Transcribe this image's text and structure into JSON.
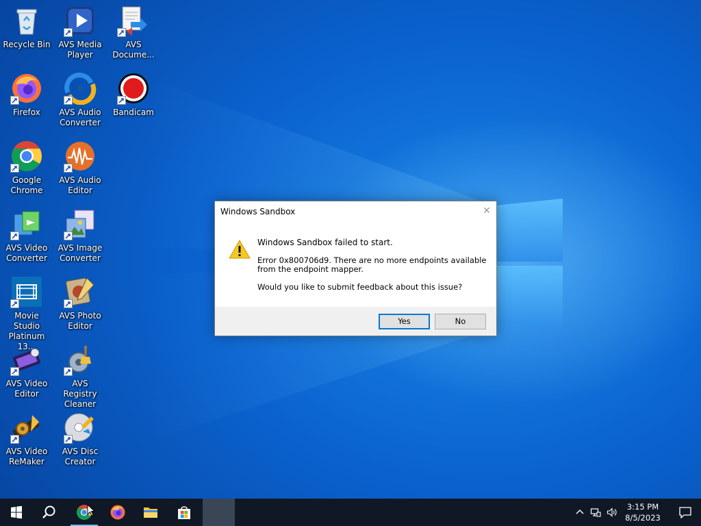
{
  "desktop": {
    "icons": [
      {
        "label": "Recycle Bin",
        "icon": "recycle-bin-icon"
      },
      {
        "label": "AVS Media Player",
        "icon": "media-player-icon"
      },
      {
        "label": "AVS Docume...",
        "icon": "document-converter-icon"
      },
      {
        "label": "Firefox",
        "icon": "firefox-icon"
      },
      {
        "label": "AVS Audio Converter",
        "icon": "audio-converter-icon"
      },
      {
        "label": "Bandicam",
        "icon": "bandicam-icon"
      },
      {
        "label": "Google Chrome",
        "icon": "chrome-icon"
      },
      {
        "label": "AVS Audio Editor",
        "icon": "audio-editor-icon"
      },
      {
        "label": "AVS Video Converter",
        "icon": "video-converter-icon"
      },
      {
        "label": "AVS Image Converter",
        "icon": "image-converter-icon"
      },
      {
        "label": "Movie Studio Platinum 13...",
        "icon": "movie-studio-icon"
      },
      {
        "label": "AVS Photo Editor",
        "icon": "photo-editor-icon"
      },
      {
        "label": "AVS Video Editor",
        "icon": "video-editor-icon"
      },
      {
        "label": "AVS Registry Cleaner",
        "icon": "registry-cleaner-icon"
      },
      {
        "label": "AVS Video ReMaker",
        "icon": "video-remaker-icon"
      },
      {
        "label": "AVS Disc Creator",
        "icon": "disc-creator-icon"
      }
    ]
  },
  "dialog": {
    "title": "Windows Sandbox",
    "close_glyph": "✕",
    "heading": "Windows Sandbox failed to start.",
    "detail": "Error 0x800706d9. There are no more endpoints available from the endpoint mapper.",
    "question": "Would you like to submit feedback about this issue?",
    "yes_label": "Yes",
    "no_label": "No"
  },
  "taskbar": {
    "items": [
      "start-icon",
      "search-icon",
      "chrome-icon",
      "firefox-icon",
      "file-explorer-icon",
      "store-icon"
    ],
    "clock_time": "3:15 PM",
    "clock_date": "8/5/2023"
  },
  "colors": {
    "accent": "#0078d7",
    "taskbar": "#101826",
    "desktop": "#0b63d0"
  }
}
